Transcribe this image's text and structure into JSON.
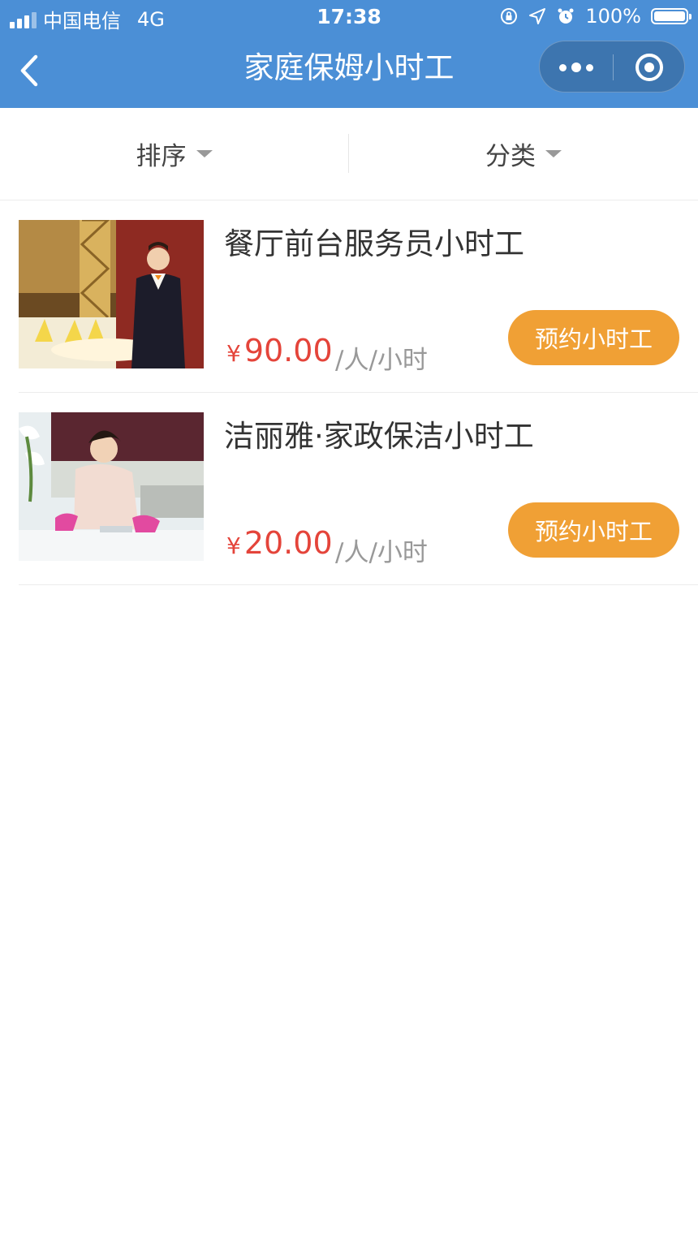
{
  "status_bar": {
    "carrier": "中国电信",
    "network": "4G",
    "time": "17:38",
    "battery": "100%",
    "icons": [
      "signal-icon",
      "orientation-lock-icon",
      "location-icon",
      "alarm-icon",
      "battery-icon"
    ]
  },
  "nav": {
    "title": "家庭保姆小时工",
    "back_icon": "chevron-left-icon",
    "more_icon": "more-dots-icon",
    "close_icon": "target-circle-icon"
  },
  "filters": {
    "sort_label": "排序",
    "category_label": "分类"
  },
  "items": [
    {
      "title": "餐厅前台服务员小时工",
      "currency": "¥",
      "price": "90.00",
      "unit": "/人/小时",
      "button": "预约小时工"
    },
    {
      "title": "洁丽雅·家政保洁小时工",
      "currency": "¥",
      "price": "20.00",
      "unit": "/人/小时",
      "button": "预约小时工"
    }
  ],
  "colors": {
    "nav_bg": "#4b8fd6",
    "price": "#e4443a",
    "button_bg": "#f0a035"
  }
}
